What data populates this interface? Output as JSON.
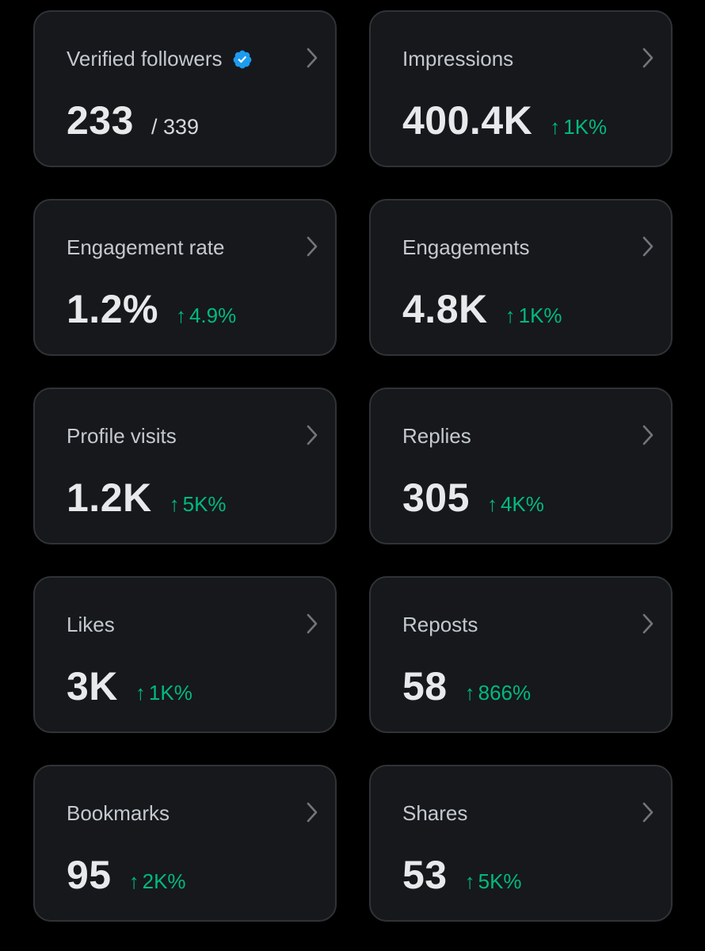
{
  "colors": {
    "background": "#000000",
    "card_background": "#16181c",
    "card_border": "#2f3336",
    "title_text": "#c4c9ce",
    "value_text": "#e7e9ea",
    "positive_change": "#00ba7c",
    "verified_badge": "#1d9bf0"
  },
  "icons": {
    "verified": "verified-badge-icon",
    "chevron": "chevron-right-icon",
    "arrow": "arrow-up-icon",
    "arrow_glyph": "↑"
  },
  "cards": {
    "verified_followers": {
      "title": "Verified followers",
      "value": "233",
      "total": "/ 339"
    },
    "impressions": {
      "title": "Impressions",
      "value": "400.4K",
      "change": "1K%"
    },
    "engagement_rate": {
      "title": "Engagement rate",
      "value": "1.2%",
      "change": "4.9%"
    },
    "engagements": {
      "title": "Engagements",
      "value": "4.8K",
      "change": "1K%"
    },
    "profile_visits": {
      "title": "Profile visits",
      "value": "1.2K",
      "change": "5K%"
    },
    "replies": {
      "title": "Replies",
      "value": "305",
      "change": "4K%"
    },
    "likes": {
      "title": "Likes",
      "value": "3K",
      "change": "1K%"
    },
    "reposts": {
      "title": "Reposts",
      "value": "58",
      "change": "866%"
    },
    "bookmarks": {
      "title": "Bookmarks",
      "value": "95",
      "change": "2K%"
    },
    "shares": {
      "title": "Shares",
      "value": "53",
      "change": "5K%"
    }
  }
}
